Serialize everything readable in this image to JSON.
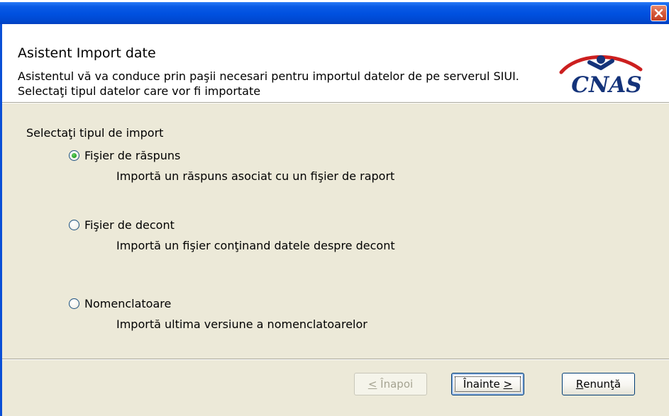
{
  "dialog": {
    "close_icon": "close-icon",
    "header": {
      "title": "Asistent Import date",
      "description": "Asistentul vă va conduce prin paşii necesari pentru importul datelor de pe serverul SIUI. Selectaţi tipul datelor care vor fi importate",
      "logo_text": "CNAS"
    },
    "prompt": "Selectaţi tipul de import",
    "options": [
      {
        "label": "Fişier de răspuns",
        "description": "Importă un răspuns asociat cu un fişier de raport",
        "checked": true
      },
      {
        "label": "Fişier de decont",
        "description": "Importă un fişier conţinand datele despre decont",
        "checked": false
      },
      {
        "label": "Nomenclatoare",
        "description": "Importă ultima versiune a nomenclatoarelor",
        "checked": false
      }
    ],
    "buttons": {
      "back_mnemonic": "<",
      "back_text": " Înapoi",
      "next_text": "Înainte ",
      "next_mnemonic": ">",
      "cancel_mnemonic": "R",
      "cancel_text": "enunţă"
    },
    "colors": {
      "titlebar": "#0050df",
      "panel": "#ece9d8",
      "logo_red": "#cc1f1f",
      "logo_blue": "#14337a"
    }
  }
}
